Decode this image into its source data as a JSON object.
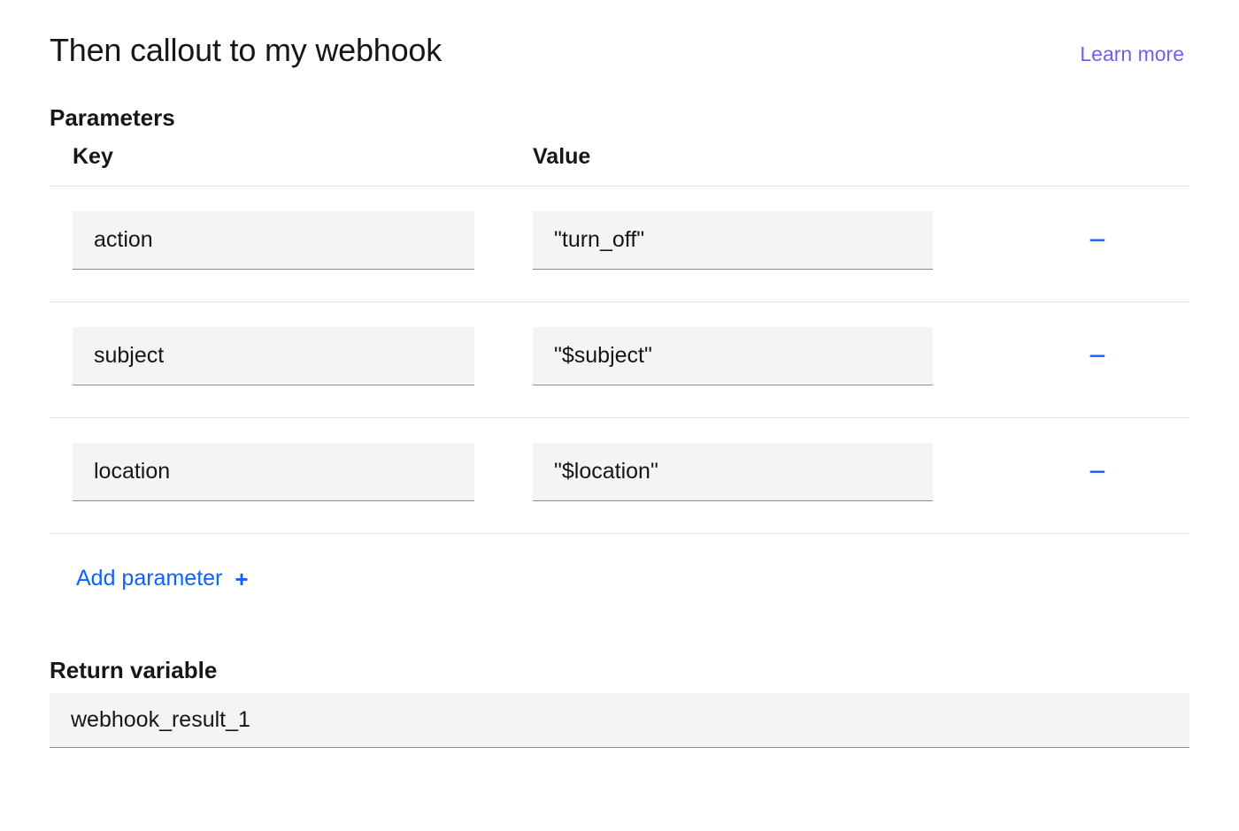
{
  "header": {
    "title": "Then callout to my webhook",
    "learn_more": "Learn more"
  },
  "sections": {
    "parameters_label": "Parameters",
    "return_label": "Return variable"
  },
  "columns": {
    "key": "Key",
    "value": "Value"
  },
  "parameters": [
    {
      "key": "action",
      "value": "\"turn_off\""
    },
    {
      "key": "subject",
      "value": "\"$subject\""
    },
    {
      "key": "location",
      "value": "\"$location\""
    }
  ],
  "actions": {
    "add_parameter": "Add parameter",
    "plus_glyph": "+",
    "remove_glyph": "−"
  },
  "return_variable": "webhook_result_1",
  "colors": {
    "link_purple": "#6f5ef0",
    "action_blue": "#0f62fe",
    "field_bg": "#f4f4f4",
    "field_underline": "#8d8d8d",
    "divider": "#e0e0e0"
  }
}
